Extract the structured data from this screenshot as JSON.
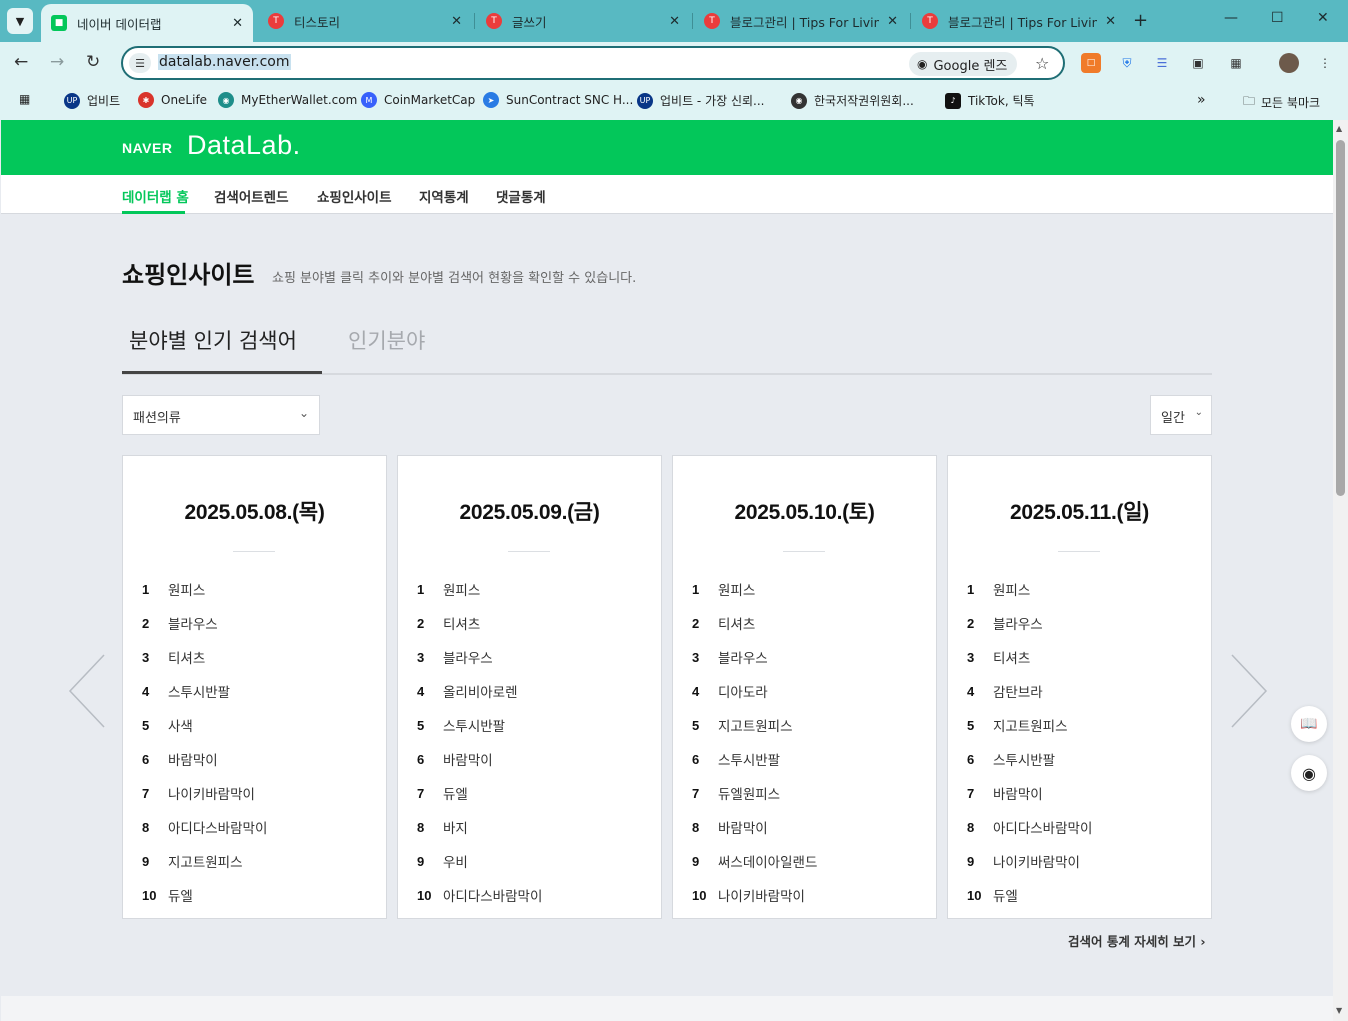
{
  "browser": {
    "tabs": [
      {
        "title": "네이버 데이터랩",
        "active": true,
        "favicon": "naver-datalab-favicon"
      },
      {
        "title": "티스토리",
        "active": false,
        "favicon": "tistory-favicon"
      },
      {
        "title": "글쓰기",
        "active": false,
        "favicon": "tistory-favicon"
      },
      {
        "title": "블로그관리 | Tips For Living",
        "active": false,
        "favicon": "tistory-favicon"
      },
      {
        "title": "블로그관리 | Tips For Living",
        "active": false,
        "favicon": "tistory-favicon"
      }
    ],
    "url": "datalab.naver.com",
    "lens_label": "Google 렌즈",
    "bookmarks": [
      {
        "label": "업비트",
        "icon": "upbit-icon"
      },
      {
        "label": "OneLife",
        "icon": "onelife-icon"
      },
      {
        "label": "MyEtherWallet.com",
        "icon": "mew-icon"
      },
      {
        "label": "CoinMarketCap",
        "icon": "coinmarketcap-icon"
      },
      {
        "label": "SunContract SNC H...",
        "icon": "suncontract-icon"
      },
      {
        "label": "업비트 - 가장 신뢰...",
        "icon": "upbit-icon"
      },
      {
        "label": "한국저작권위원회...",
        "icon": "copyright-icon"
      },
      {
        "label": "TikTok, 틱톡",
        "icon": "tiktok-icon"
      }
    ],
    "all_bookmarks_label": "모든 북마크"
  },
  "header": {
    "naver": "NAVER",
    "datalab": "DataLab."
  },
  "gnb": {
    "items": [
      "데이터랩 홈",
      "검색어트렌드",
      "쇼핑인사이트",
      "지역통계",
      "댓글통계"
    ],
    "active_index": 0
  },
  "section": {
    "title": "쇼핑인사이트",
    "description": "쇼핑 분야별 클릭 추이와 분야별 검색어 현황을 확인할 수 있습니다."
  },
  "page_tabs": {
    "items": [
      "분야별 인기 검색어",
      "인기분야"
    ],
    "active_index": 0
  },
  "filters": {
    "category": "패션의류",
    "period": "일간"
  },
  "cards": [
    {
      "date": "2025.05.08.(목)",
      "items": [
        "원피스",
        "블라우스",
        "티셔츠",
        "스투시반팔",
        "사색",
        "바람막이",
        "나이키바람막이",
        "아디다스바람막이",
        "지고트원피스",
        "듀엘"
      ]
    },
    {
      "date": "2025.05.09.(금)",
      "items": [
        "원피스",
        "티셔츠",
        "블라우스",
        "올리비아로렌",
        "스투시반팔",
        "바람막이",
        "듀엘",
        "바지",
        "우비",
        "아디다스바람막이"
      ]
    },
    {
      "date": "2025.05.10.(토)",
      "items": [
        "원피스",
        "티셔츠",
        "블라우스",
        "디아도라",
        "지고트원피스",
        "스투시반팔",
        "듀엘원피스",
        "바람막이",
        "써스데이아일랜드",
        "나이키바람막이"
      ]
    },
    {
      "date": "2025.05.11.(일)",
      "items": [
        "원피스",
        "블라우스",
        "티셔츠",
        "감탄브라",
        "지고트원피스",
        "스투시반팔",
        "바람막이",
        "아디다스바람막이",
        "나이키바람막이",
        "듀엘"
      ]
    }
  ],
  "more_link": "검색어 통계 자세히 보기",
  "colors": {
    "naver_green": "#03c75a",
    "chrome_tab_bar": "#58b9c2",
    "chrome_toolbar": "#dff3f4"
  }
}
